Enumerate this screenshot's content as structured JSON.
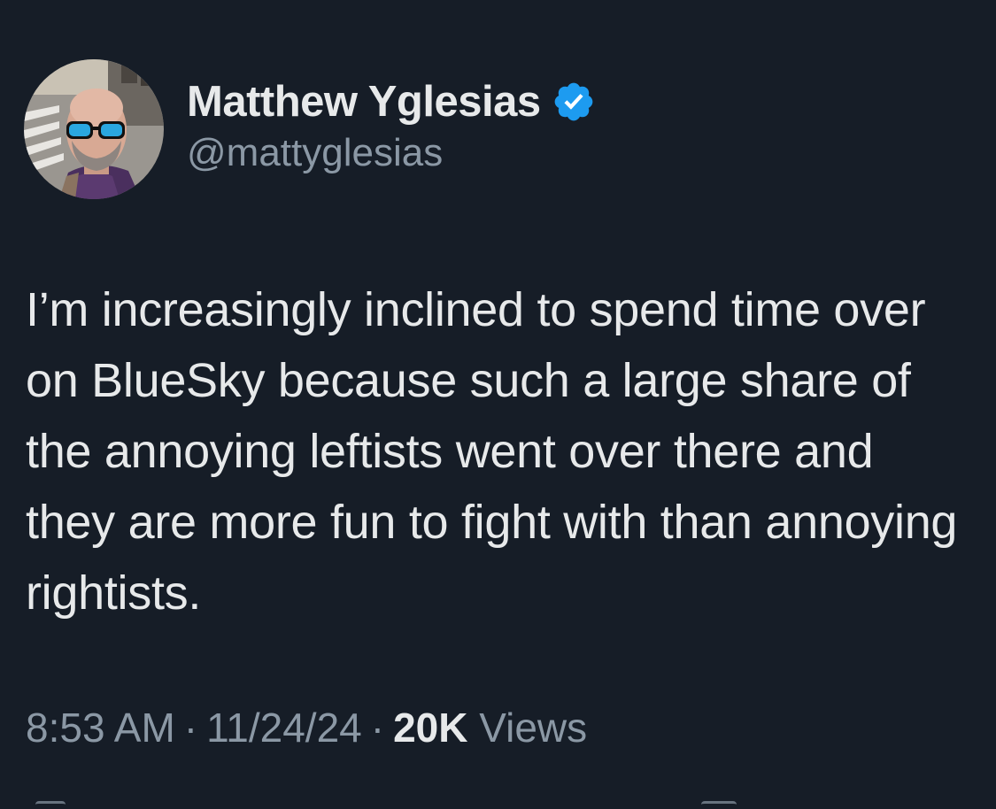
{
  "author": {
    "display_name": "Matthew Yglesias",
    "handle": "@mattyglesias",
    "verified": true,
    "avatar_icon": "profile-photo",
    "badge_icon": "verified-badge-icon",
    "badge_color": "#1d9bf0"
  },
  "tweet": {
    "text": "I’m increasingly inclined to spend time over on BlueSky because such a large share of the annoying leftists went over there and they are more fun to fight with than annoying rightists."
  },
  "meta": {
    "time": "8:53 AM",
    "separator": "·",
    "date": "11/24/24",
    "views_count": "20K",
    "views_label": "Views"
  },
  "colors": {
    "background": "#161d27",
    "primary_text": "#e7e9ea",
    "secondary_text": "#8b98a5",
    "accent": "#1d9bf0"
  }
}
